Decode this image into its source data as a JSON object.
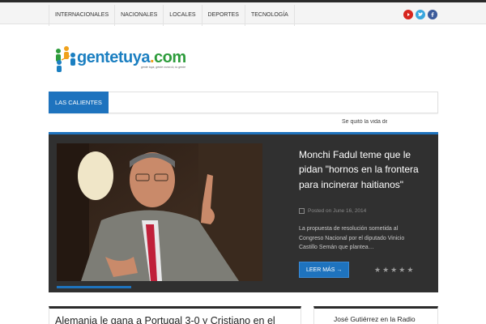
{
  "nav": {
    "items": [
      "INTERNACIONALES",
      "NACIONALES",
      "LOCALES",
      "DEPORTES",
      "TECNOLOGÍA"
    ]
  },
  "social": {
    "youtube_color": "#d7261f",
    "twitter_color": "#39a6de",
    "facebook_color": "#3b5a9a"
  },
  "logo": {
    "text_main": "gentetuya",
    "text_dot": ".",
    "text_com": "com",
    "tagline": "gente tuya, gente como tú, tu gente"
  },
  "hot": {
    "label": "LAS CALIENTES"
  },
  "ticker": {
    "text": "Se quitó la vida de"
  },
  "featured": {
    "title": "Monchi Fadul teme que le pidan \"hornos en la frontera para incinerar haitianos\"",
    "date": "Posted on June 16, 2014",
    "excerpt": "La propuesta de resolución sometida al Congreso Nacional por el diputado Vinicio Castillo Semán que plantea…",
    "read_more": "LEER MÁS →",
    "rating_stars": 5
  },
  "posts": {
    "headline": "Alemania le gana a Portugal 3-0 y Cristiano en el"
  },
  "sidebar": {
    "headline": "José Gutiérrez en la Radio"
  },
  "colors": {
    "accent": "#1e73be",
    "dark": "#303030"
  }
}
